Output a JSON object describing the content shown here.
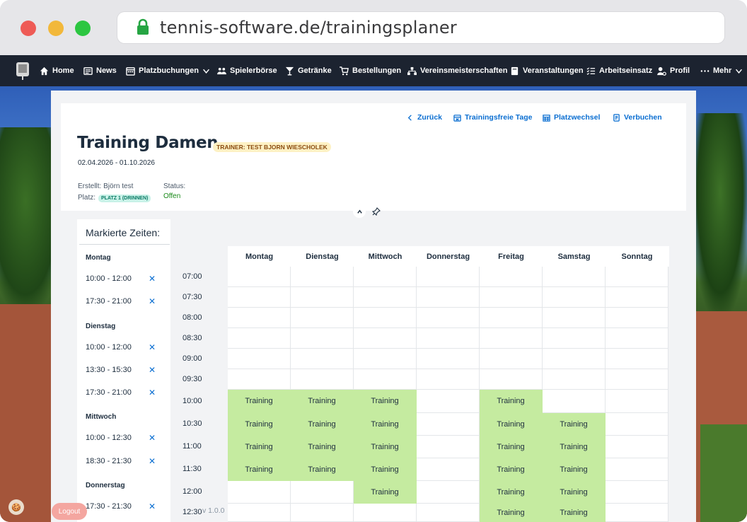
{
  "browser": {
    "url": "tennis-software.de/trainingsplaner"
  },
  "nav": {
    "items": [
      {
        "label": "Home",
        "icon": "home-icon"
      },
      {
        "label": "News",
        "icon": "news-icon"
      },
      {
        "label": "Platzbuchungen",
        "icon": "calendar-icon",
        "dropdown": true
      },
      {
        "label": "Spielerbörse",
        "icon": "people-icon"
      },
      {
        "label": "Getränke",
        "icon": "glass-icon"
      },
      {
        "label": "Bestellungen",
        "icon": "cart-icon"
      },
      {
        "label": "Vereinsmeisterschaften",
        "icon": "hierarchy-icon"
      },
      {
        "label": "Veranstaltungen",
        "icon": "event-icon"
      },
      {
        "label": "Arbeitseinsatz",
        "icon": "checklist-icon"
      },
      {
        "label": "Profil",
        "icon": "user-settings-icon"
      },
      {
        "label": "Mehr",
        "icon": "more-icon",
        "dropdown": true
      }
    ]
  },
  "actions": {
    "back": "Zurück",
    "free_days": "Trainingsfreie Tage",
    "court_change": "Platzwechsel",
    "book": "Verbuchen"
  },
  "training": {
    "title": "Training Damen",
    "trainer_badge": "TRAINER: TEST BJORN WIESCHOLEK",
    "date_range": "02.04.2026 - 01.10.2026",
    "created_by": "Erstellt: Björn test",
    "court_label": "Platz:",
    "court_badge": "PLATZ 1 (DRINNEN)",
    "status_label": "Status:",
    "status_value": "Offen"
  },
  "marked": {
    "title": "Markierte Zeiten:",
    "days": [
      {
        "day": "Montag",
        "slots": [
          "10:00 - 12:00",
          "17:30 - 21:00"
        ]
      },
      {
        "day": "Dienstag",
        "slots": [
          "10:00 - 12:00",
          "13:30 - 15:30",
          "17:30 - 21:00"
        ]
      },
      {
        "day": "Mittwoch",
        "slots": [
          "10:00 - 12:30",
          "18:30 - 21:30"
        ]
      },
      {
        "day": "Donnerstag",
        "slots": [
          "17:30 - 21:30"
        ]
      }
    ]
  },
  "schedule": {
    "days": [
      "Montag",
      "Dienstag",
      "Mittwoch",
      "Donnerstag",
      "Freitag",
      "Samstag",
      "Sonntag"
    ],
    "times": [
      "07:00",
      "07:30",
      "08:00",
      "08:30",
      "09:00",
      "09:30",
      "10:00",
      "10:30",
      "11:00",
      "11:30",
      "12:00",
      "12:30"
    ],
    "entry_label": "Training",
    "booked": {
      "10:00": [
        1,
        1,
        1,
        0,
        1,
        0,
        0
      ],
      "10:30": [
        1,
        1,
        1,
        0,
        1,
        1,
        0
      ],
      "11:00": [
        1,
        1,
        1,
        0,
        1,
        1,
        0
      ],
      "11:30": [
        1,
        1,
        1,
        0,
        1,
        1,
        0
      ],
      "12:00": [
        0,
        0,
        1,
        0,
        1,
        1,
        0
      ],
      "12:30": [
        0,
        0,
        0,
        0,
        1,
        1,
        0
      ]
    }
  },
  "footer": {
    "logout": "Logout",
    "version": "v 1.0.0"
  },
  "colors": {
    "accent": "#0a6ed1",
    "booked": "#c5eba0",
    "nav_bg": "#1c2330"
  }
}
